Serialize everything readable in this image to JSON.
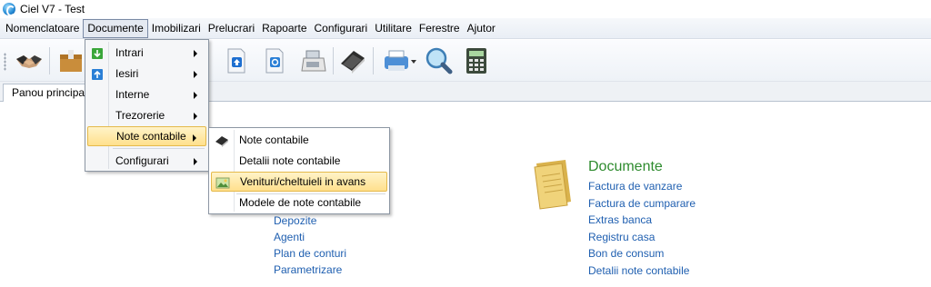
{
  "window": {
    "title": "Ciel V7 - Test"
  },
  "menubar": {
    "items": [
      {
        "label": "Nomenclatoare"
      },
      {
        "label": "Documente"
      },
      {
        "label": "Imobilizari"
      },
      {
        "label": "Prelucrari"
      },
      {
        "label": "Rapoarte"
      },
      {
        "label": "Configurari"
      },
      {
        "label": "Utilitare"
      },
      {
        "label": "Ferestre"
      },
      {
        "label": "Ajutor"
      }
    ]
  },
  "tabs": [
    {
      "label": "Panou principal"
    }
  ],
  "documente_menu": {
    "items": [
      {
        "label": "Intrari"
      },
      {
        "label": "Iesiri"
      },
      {
        "label": "Interne"
      },
      {
        "label": "Trezorerie"
      },
      {
        "label": "Note contabile"
      },
      {
        "label": "Configurari"
      }
    ]
  },
  "note_contabile_menu": {
    "items": [
      {
        "label": "Note contabile"
      },
      {
        "label": "Detalii note contabile"
      },
      {
        "label": "Venituri/cheltuieli in avans"
      },
      {
        "label": "Modele de note contabile"
      }
    ]
  },
  "left_links": [
    "Depozite",
    "Agenti",
    "Plan de conturi",
    "Parametrizare"
  ],
  "documente_section": {
    "title": "Documente",
    "links": [
      "Factura de vanzare",
      "Factura de cumparare",
      "Extras banca",
      "Registru casa",
      "Bon de consum",
      "Detalii note contabile"
    ]
  },
  "colors": {
    "link": "#1f5fb0",
    "section_title": "#2e8b2e",
    "highlight": "#ffe08c"
  },
  "toolbar_icons": [
    "handshake-icon",
    "package-icon",
    "upload-doc-icon",
    "refresh-doc-icon",
    "cash-register-icon",
    "book-icon",
    "print-icon",
    "search-icon",
    "calculator-icon"
  ]
}
